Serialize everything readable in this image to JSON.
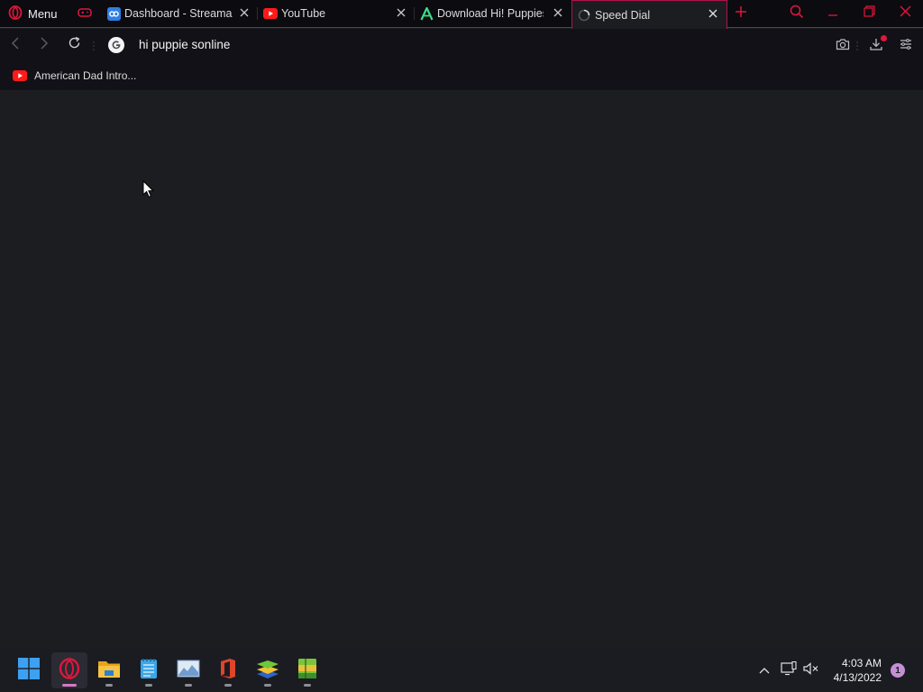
{
  "browser": {
    "menu_label": "Menu",
    "tabs": [
      {
        "label": "",
        "icon": "game-controller-icon"
      },
      {
        "label": "Dashboard - Streamab",
        "icon": "streamable-icon"
      },
      {
        "label": "YouTube",
        "icon": "youtube-icon"
      },
      {
        "label": "Download Hi! Puppies",
        "icon": "android-a-icon"
      },
      {
        "label": "Speed Dial",
        "icon": "loading-spinner-icon",
        "active": true
      }
    ],
    "address_text": "hi puppie sonline",
    "bookmarks": [
      {
        "label": "American Dad Intro...",
        "icon": "youtube-icon"
      }
    ]
  },
  "taskbar": {
    "apps": [
      "start",
      "opera",
      "file-explorer",
      "notepad",
      "photos",
      "office",
      "bluestacks",
      "winrar"
    ],
    "time": "4:03 AM",
    "date": "4/13/2022",
    "notification_count": "1"
  },
  "colors": {
    "accent": "#b3124a",
    "background": "#1c1d21",
    "bar": "#111117"
  }
}
